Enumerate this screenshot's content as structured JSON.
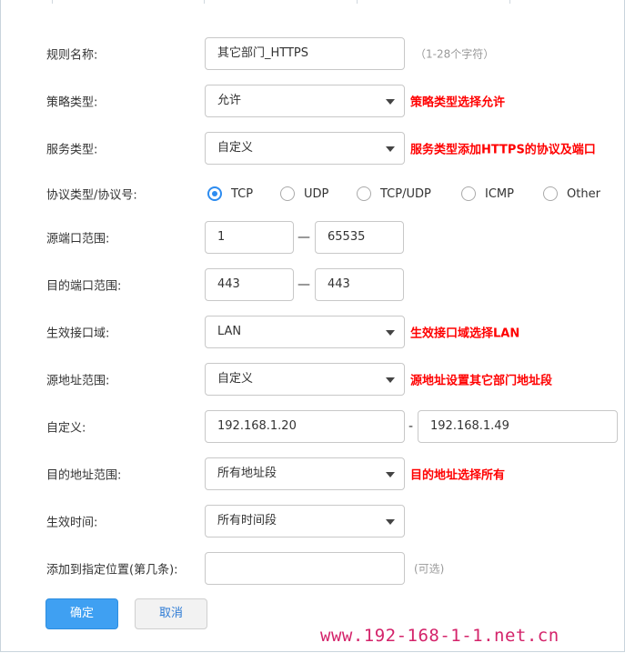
{
  "form": {
    "rule_name": {
      "label": "规则名称:",
      "value": "其它部门_HTTPS",
      "hint": "（1-28个字符）"
    },
    "policy_type": {
      "label": "策略类型:",
      "value": "允许",
      "note": "策略类型选择允许"
    },
    "service_type": {
      "label": "服务类型:",
      "value": "自定义",
      "note": "服务类型添加HTTPS的协议及端口"
    },
    "protocol": {
      "label": "协议类型/协议号:",
      "options": [
        "TCP",
        "UDP",
        "TCP/UDP",
        "ICMP",
        "Other"
      ],
      "selected": "TCP"
    },
    "src_port": {
      "label": "源端口范围:",
      "from": "1",
      "to": "65535",
      "sep": "—"
    },
    "dst_port": {
      "label": "目的端口范围:",
      "from": "443",
      "to": "443",
      "sep": "—"
    },
    "zone": {
      "label": "生效接口域:",
      "value": "LAN",
      "note": "生效接口域选择LAN"
    },
    "src_addr": {
      "label": "源地址范围:",
      "value": "自定义",
      "note": "源地址设置其它部门地址段"
    },
    "custom": {
      "label": "自定义:",
      "from": "192.168.1.20",
      "to": "192.168.1.49",
      "sep": "-"
    },
    "dst_addr": {
      "label": "目的地址范围:",
      "value": "所有地址段",
      "note": "目的地址选择所有"
    },
    "time": {
      "label": "生效时间:",
      "value": "所有时间段"
    },
    "position": {
      "label": "添加到指定位置(第几条):",
      "value": "",
      "hint": "(可选)"
    }
  },
  "buttons": {
    "ok": "确定",
    "cancel": "取消"
  },
  "watermark": "www.192-168-1-1.net.cn",
  "colors": {
    "note": "#ff0000",
    "primary": "#3fa0f2",
    "radio": "#2d8cf0",
    "watermark": "#d4236a"
  }
}
